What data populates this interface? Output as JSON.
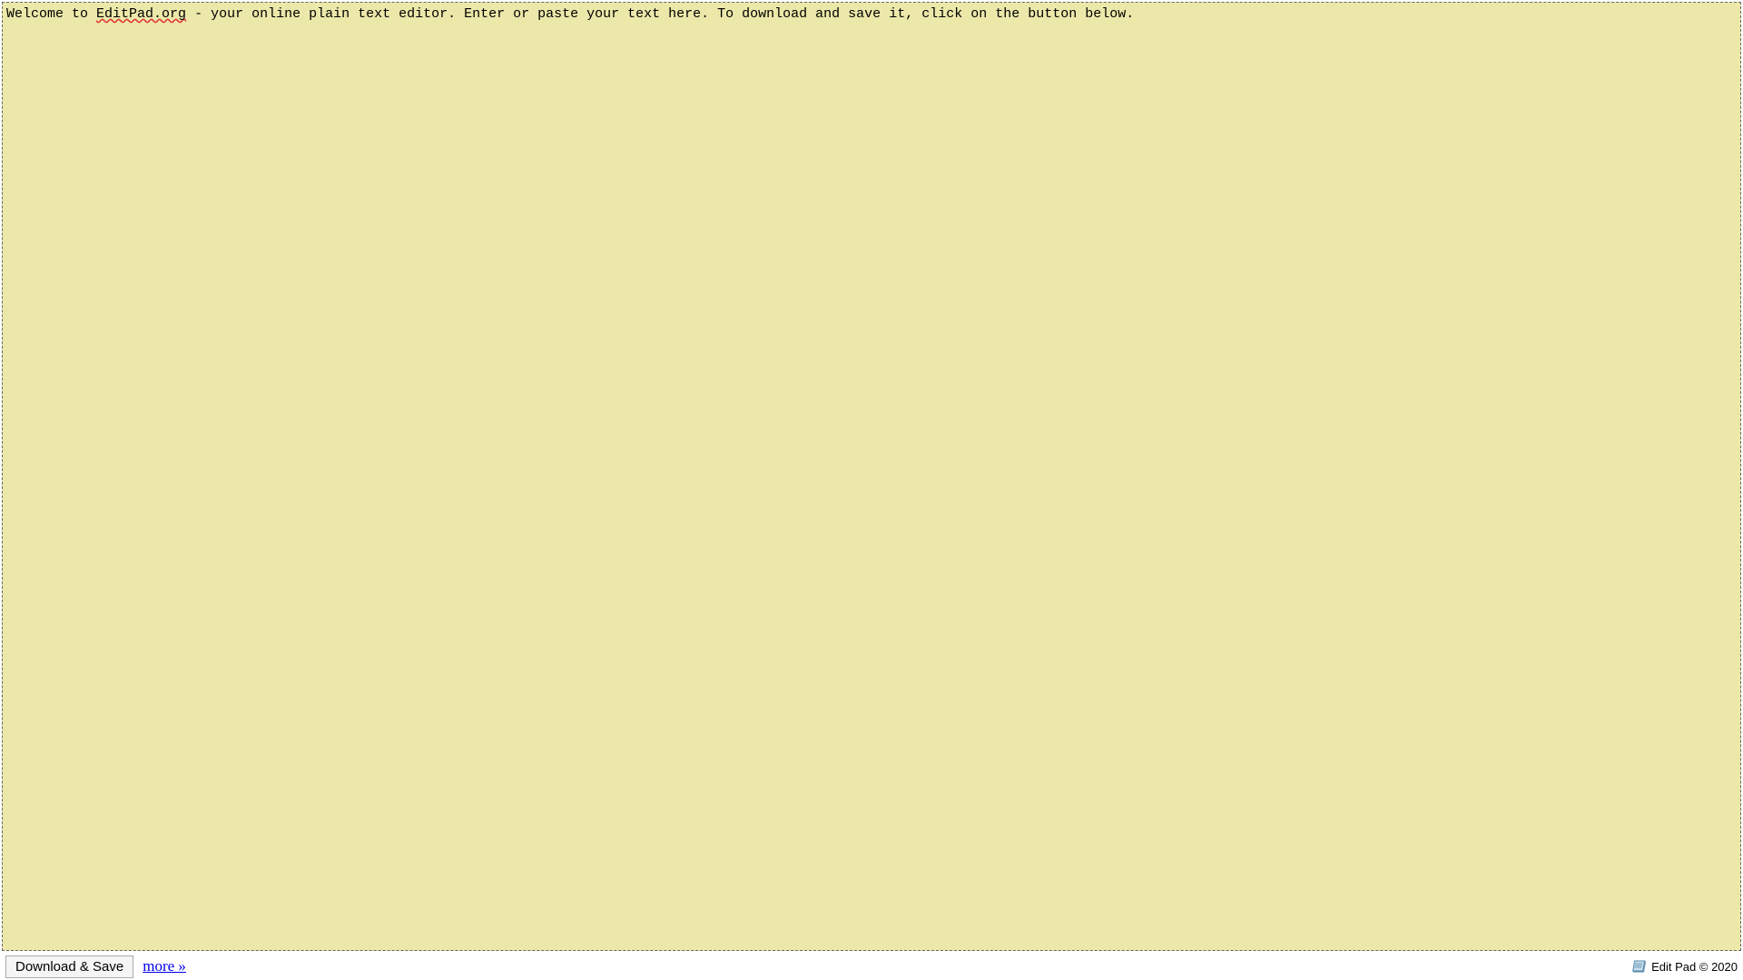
{
  "editor": {
    "text_prefix": "Welcome to ",
    "text_spellcheck": "EditPad.org",
    "text_suffix": " - your online plain text editor. Enter or paste your text here. To download and save it, click on the button below."
  },
  "toolbar": {
    "download_label": "Download & Save",
    "more_label": "more »"
  },
  "footer": {
    "copyright": "Edit Pad © 2020"
  }
}
